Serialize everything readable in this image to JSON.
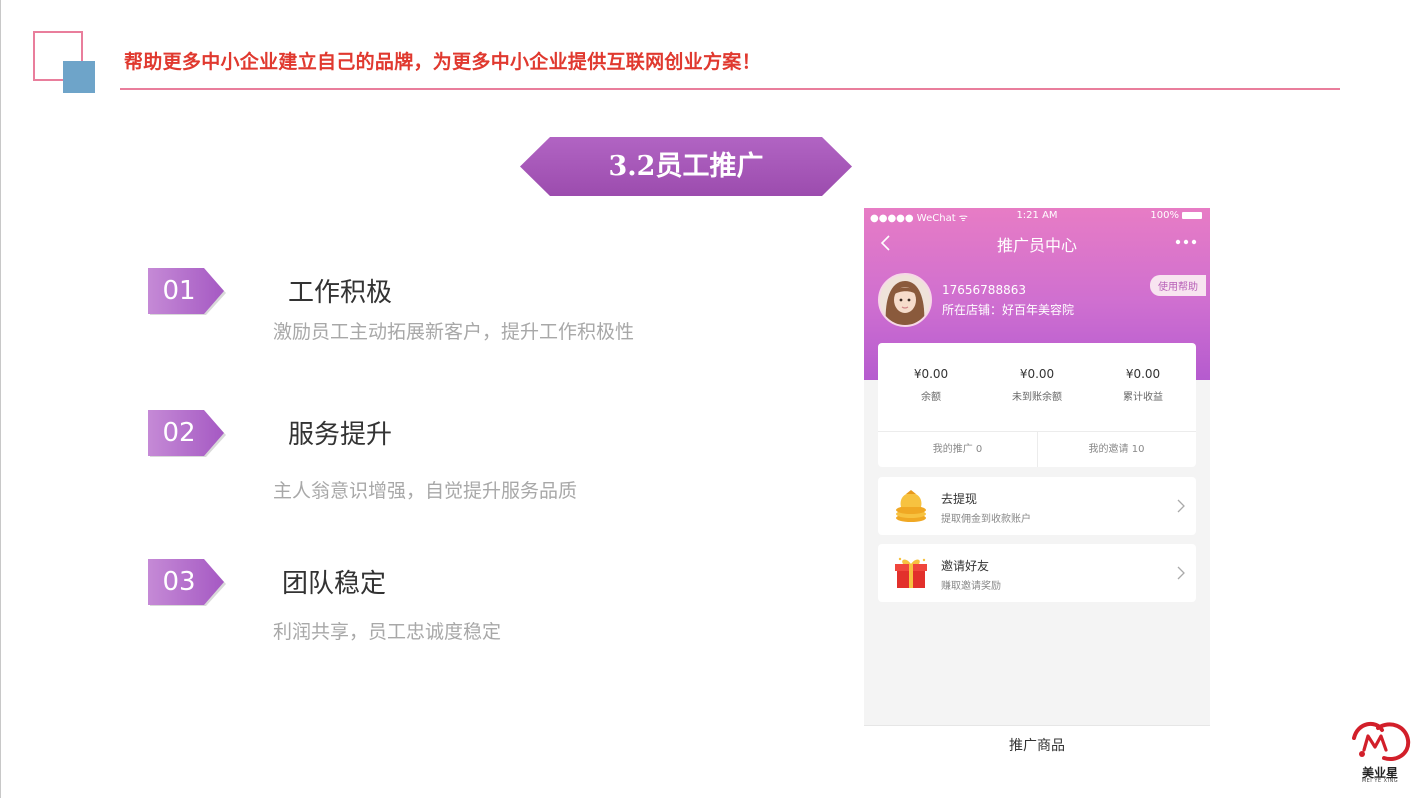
{
  "header": {
    "tagline": "帮助更多中小企业建立自己的品牌，为更多中小企业提供互联网创业方案！"
  },
  "banner": {
    "title": "3.2员工推广"
  },
  "features": [
    {
      "number": "01",
      "title": "工作积极",
      "desc": "激励员工主动拓展新客户，提升工作积极性"
    },
    {
      "number": "02",
      "title": "服务提升",
      "desc": "主人翁意识增强，自觉提升服务品质"
    },
    {
      "number": "03",
      "title": "团队稳定",
      "desc": "利润共享，员工忠诚度稳定"
    }
  ],
  "phone": {
    "status": {
      "carrier": "●●●●● WeChat ᯤ",
      "time": "1:21 AM",
      "battery": "100%"
    },
    "nav_title": "推广员中心",
    "profile": {
      "phone": "17656788863",
      "store": "所在店铺：好百年美容院",
      "help": "使用帮助"
    },
    "stats": [
      {
        "value": "¥0.00",
        "label": "余额"
      },
      {
        "value": "¥0.00",
        "label": "未到账余额"
      },
      {
        "value": "¥0.00",
        "label": "累计收益"
      }
    ],
    "tabs": {
      "promotions": "我的推广 0",
      "invites": "我的邀请 10"
    },
    "menu": [
      {
        "title": "去提现",
        "sub": "提取佣金到收款账户",
        "icon": "coins-icon"
      },
      {
        "title": "邀请好友",
        "sub": "赚取邀请奖励",
        "icon": "gift-icon"
      }
    ],
    "bottom_label": "推广商品"
  },
  "brand": {
    "name": "美业星",
    "sub": "MEI YE XING"
  },
  "colors": {
    "accent_pink": "#e97e9c",
    "tagline_red": "#e0392f",
    "banner_purple": "#a855b8",
    "square_blue": "#6ea4c9"
  }
}
